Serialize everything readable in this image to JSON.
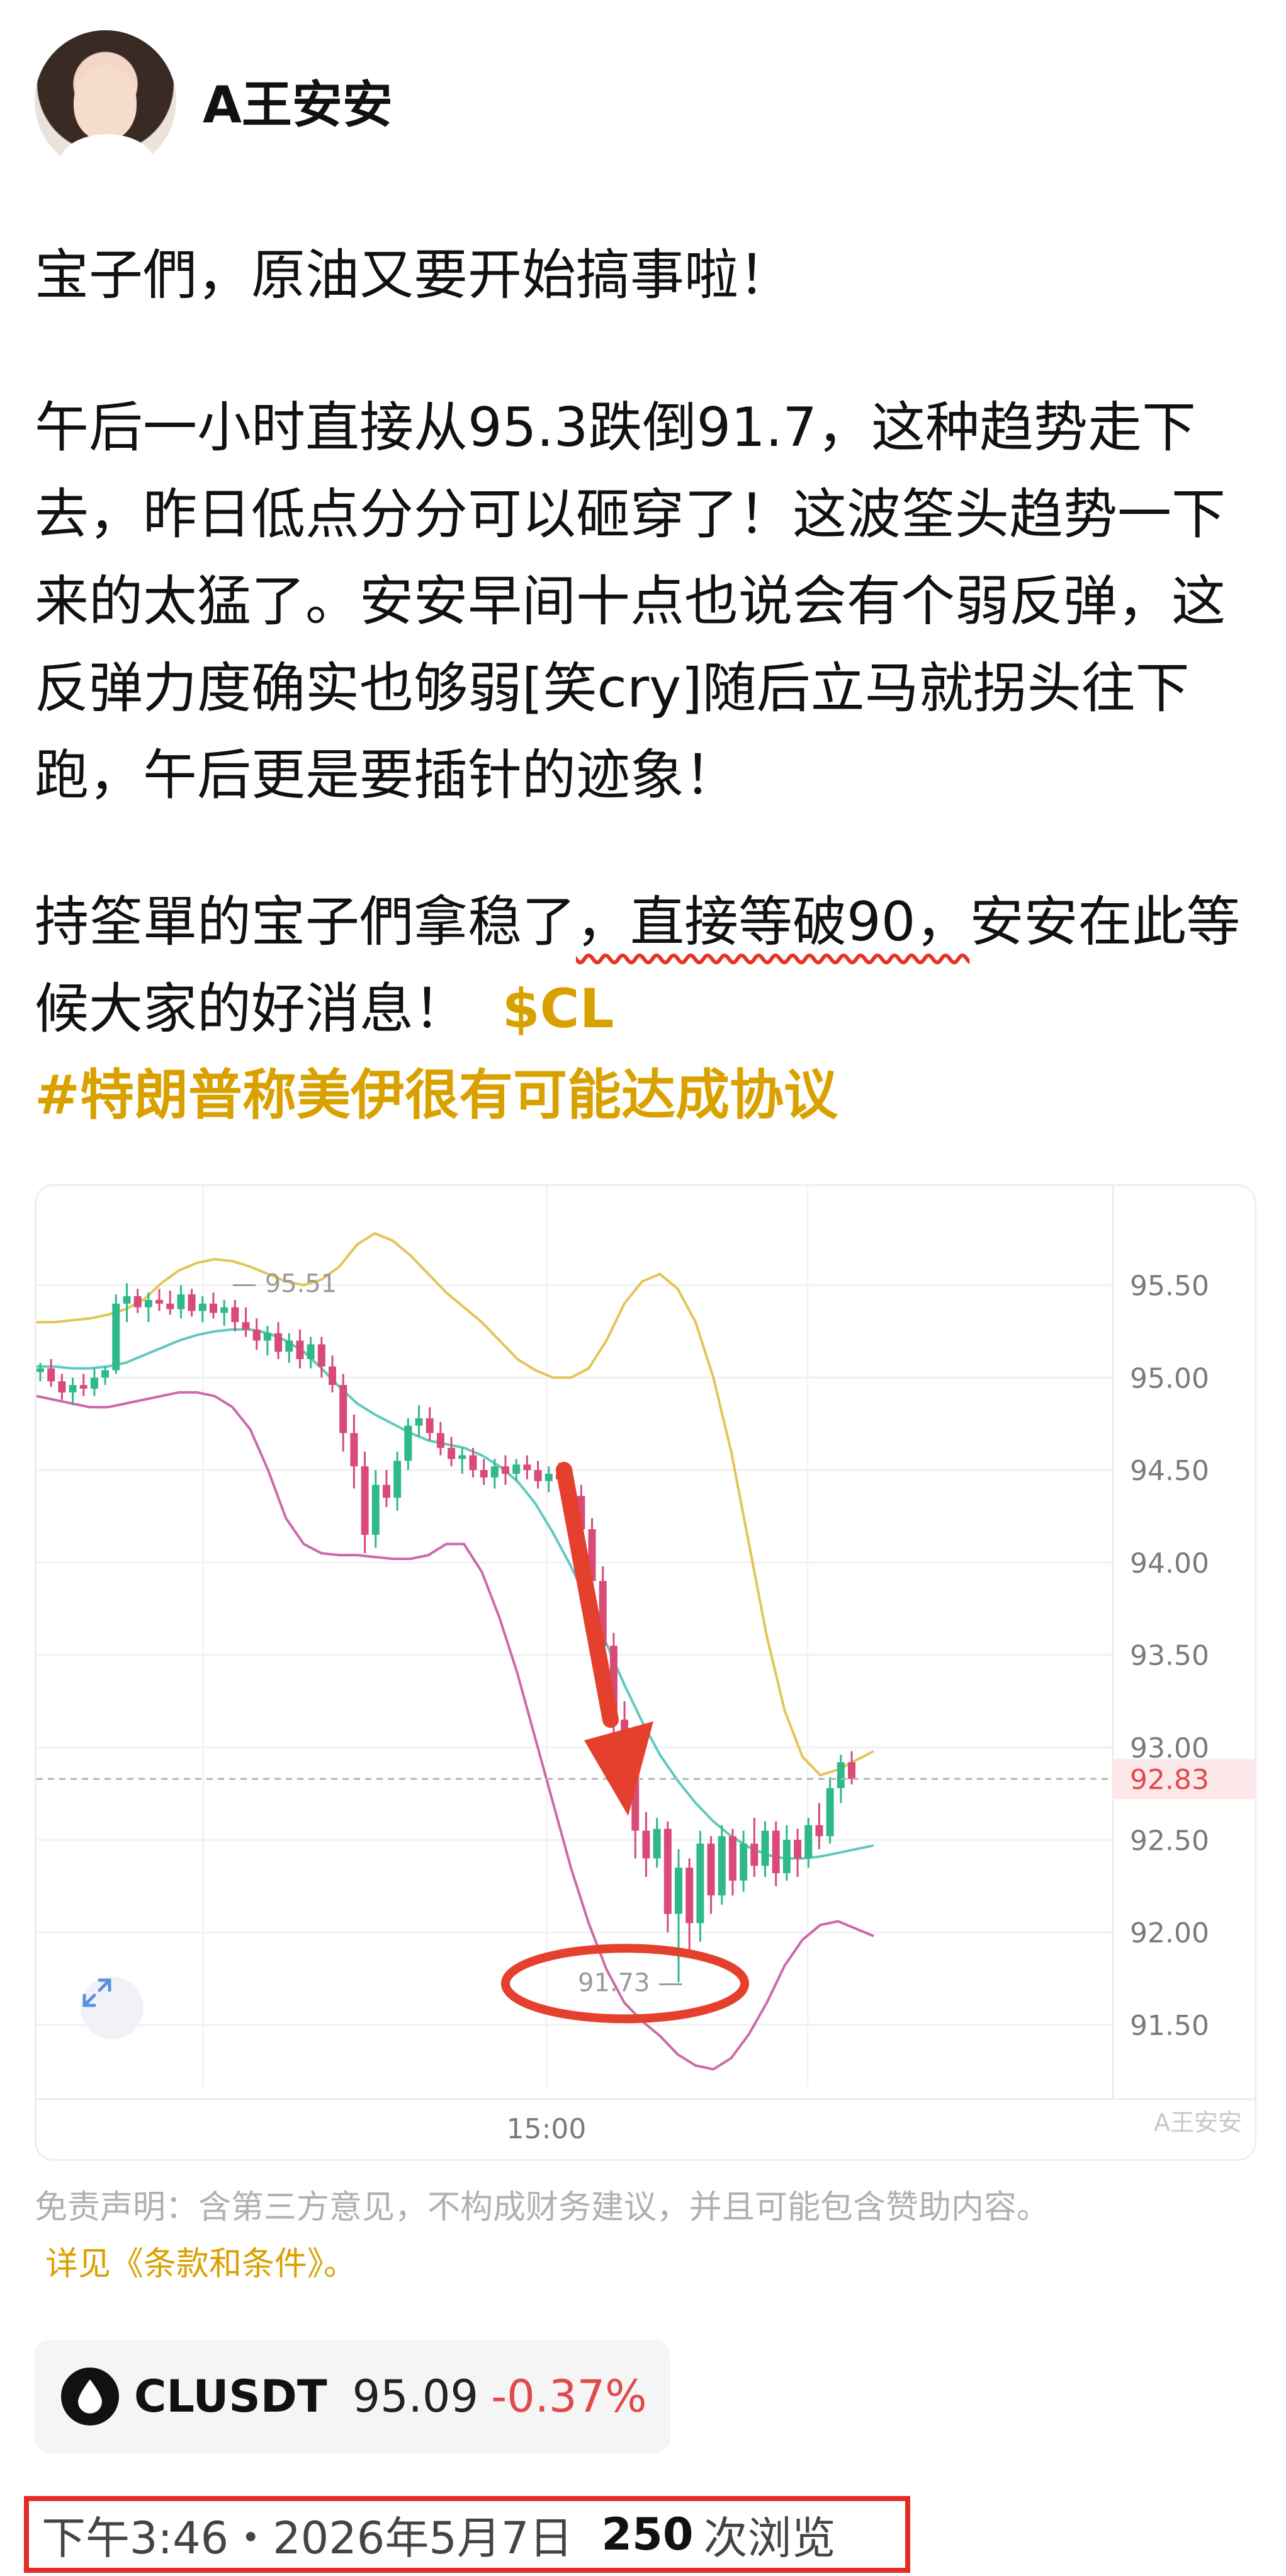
{
  "post": {
    "author": "A王安安",
    "paragraph1": "宝子們，原油又要开始搞事啦！",
    "paragraph2": "午后一小时直接从95.3跌倒91.7，这种趋势走下去，昨日低点分分可以砸穿了！这波筌头趋势一下来的太猛了。安安早间十点也说会有个弱反弹，这反弹力度确实也够弱[笑cry]随后立马就拐头往下跑，午后更是要插针的迹象！",
    "paragraph3_before": "持筌單的宝子們拿稳了",
    "paragraph3_highlight": "，直接等破90，",
    "paragraph3_after": "安安在此等候大家的好消息！",
    "cashtag": "$CL",
    "hashtag": "#特朗普称美伊很有可能达成协议"
  },
  "chart_data": {
    "type": "candlestick",
    "y_ticks": [
      "95.50",
      "95.00",
      "94.50",
      "94.00",
      "93.50",
      "93.00",
      "92.50",
      "92.00",
      "91.50"
    ],
    "ylim": [
      91.2,
      95.9
    ],
    "x_tick": "15:00",
    "current_price": "92.83",
    "high_label": "95.51",
    "low_label": "91.73",
    "watermark": "A王安安",
    "colors": {
      "up": "#2fb98a",
      "down": "#d94a76",
      "upper_band": "#e3c457",
      "mid_band": "#5fc9c0",
      "lower_band": "#cc6aa8",
      "annotation": "#e4402d"
    },
    "candles": [
      [
        95.03,
        95.08,
        94.98,
        95.05
      ],
      [
        95.05,
        95.1,
        94.95,
        94.98
      ],
      [
        94.98,
        95.02,
        94.88,
        94.92
      ],
      [
        94.92,
        95.0,
        94.85,
        94.96
      ],
      [
        94.96,
        95.02,
        94.9,
        94.94
      ],
      [
        94.94,
        95.05,
        94.9,
        95.0
      ],
      [
        95.0,
        95.06,
        94.96,
        95.04
      ],
      [
        95.04,
        95.45,
        95.02,
        95.4
      ],
      [
        95.4,
        95.51,
        95.3,
        95.44
      ],
      [
        95.44,
        95.48,
        95.35,
        95.38
      ],
      [
        95.38,
        95.46,
        95.3,
        95.42
      ],
      [
        95.42,
        95.48,
        95.36,
        95.4
      ],
      [
        95.4,
        95.47,
        95.34,
        95.37
      ],
      [
        95.37,
        95.5,
        95.32,
        95.45
      ],
      [
        95.45,
        95.48,
        95.33,
        95.36
      ],
      [
        95.36,
        95.44,
        95.3,
        95.4
      ],
      [
        95.4,
        95.46,
        95.32,
        95.35
      ],
      [
        95.35,
        95.42,
        95.28,
        95.38
      ],
      [
        95.38,
        95.42,
        95.25,
        95.3
      ],
      [
        95.3,
        95.38,
        95.22,
        95.26
      ],
      [
        95.26,
        95.32,
        95.15,
        95.2
      ],
      [
        95.2,
        95.28,
        95.12,
        95.24
      ],
      [
        95.24,
        95.3,
        95.1,
        95.14
      ],
      [
        95.14,
        95.24,
        95.08,
        95.2
      ],
      [
        95.2,
        95.26,
        95.05,
        95.1
      ],
      [
        95.1,
        95.22,
        95.05,
        95.18
      ],
      [
        95.18,
        95.22,
        95.0,
        95.06
      ],
      [
        95.06,
        95.12,
        94.92,
        94.96
      ],
      [
        94.96,
        95.02,
        94.6,
        94.7
      ],
      [
        94.7,
        94.8,
        94.4,
        94.52
      ],
      [
        94.52,
        94.6,
        94.05,
        94.15
      ],
      [
        94.15,
        94.5,
        94.08,
        94.42
      ],
      [
        94.42,
        94.5,
        94.3,
        94.35
      ],
      [
        94.35,
        94.6,
        94.28,
        94.55
      ],
      [
        94.55,
        94.78,
        94.5,
        94.74
      ],
      [
        94.74,
        94.85,
        94.68,
        94.78
      ],
      [
        94.78,
        94.84,
        94.66,
        94.7
      ],
      [
        94.7,
        94.76,
        94.58,
        94.62
      ],
      [
        94.62,
        94.68,
        94.52,
        94.56
      ],
      [
        94.56,
        94.62,
        94.48,
        94.58
      ],
      [
        94.58,
        94.62,
        94.46,
        94.5
      ],
      [
        94.5,
        94.56,
        94.42,
        94.46
      ],
      [
        94.46,
        94.56,
        94.4,
        94.52
      ],
      [
        94.52,
        94.58,
        94.42,
        94.48
      ],
      [
        94.48,
        94.56,
        94.44,
        94.53
      ],
      [
        94.53,
        94.58,
        94.45,
        94.5
      ],
      [
        94.5,
        94.55,
        94.4,
        94.44
      ],
      [
        94.44,
        94.52,
        94.38,
        94.48
      ],
      [
        94.48,
        94.54,
        94.4,
        94.45
      ],
      [
        94.45,
        94.5,
        94.3,
        94.36
      ],
      [
        94.36,
        94.42,
        94.1,
        94.18
      ],
      [
        94.18,
        94.24,
        93.8,
        93.9
      ],
      [
        93.9,
        93.98,
        93.4,
        93.55
      ],
      [
        93.55,
        93.62,
        93.0,
        93.15
      ],
      [
        93.15,
        93.25,
        92.7,
        92.85
      ],
      [
        92.85,
        92.95,
        92.4,
        92.55
      ],
      [
        92.55,
        92.65,
        92.3,
        92.4
      ],
      [
        92.4,
        92.62,
        92.35,
        92.56
      ],
      [
        92.56,
        92.6,
        92.0,
        92.1
      ],
      [
        92.1,
        92.45,
        91.73,
        92.35
      ],
      [
        92.35,
        92.4,
        91.9,
        92.05
      ],
      [
        92.05,
        92.55,
        91.95,
        92.48
      ],
      [
        92.48,
        92.52,
        92.1,
        92.2
      ],
      [
        92.2,
        92.58,
        92.15,
        92.52
      ],
      [
        92.52,
        92.56,
        92.2,
        92.28
      ],
      [
        92.28,
        92.55,
        92.22,
        92.48
      ],
      [
        92.48,
        92.62,
        92.3,
        92.36
      ],
      [
        92.36,
        92.6,
        92.3,
        92.55
      ],
      [
        92.55,
        92.6,
        92.25,
        92.32
      ],
      [
        92.32,
        92.58,
        92.28,
        92.5
      ],
      [
        92.5,
        92.56,
        92.3,
        92.4
      ],
      [
        92.4,
        92.62,
        92.35,
        92.58
      ],
      [
        92.58,
        92.7,
        92.45,
        92.52
      ],
      [
        92.52,
        92.84,
        92.48,
        92.78
      ],
      [
        92.78,
        92.96,
        92.7,
        92.92
      ],
      [
        92.92,
        92.98,
        92.8,
        92.83
      ]
    ],
    "upper_band": [
      95.3,
      95.3,
      95.31,
      95.32,
      95.34,
      95.37,
      95.42,
      95.51,
      95.58,
      95.62,
      95.64,
      95.63,
      95.6,
      95.56,
      95.52,
      95.5,
      95.53,
      95.6,
      95.72,
      95.78,
      95.74,
      95.66,
      95.56,
      95.46,
      95.38,
      95.3,
      95.2,
      95.1,
      95.04,
      95.0,
      95.0,
      95.05,
      95.2,
      95.4,
      95.52,
      95.56,
      95.48,
      95.3,
      95.0,
      94.6,
      94.1,
      93.6,
      93.2,
      92.95,
      92.85,
      92.88,
      92.93,
      92.98
    ],
    "mid_band": [
      95.06,
      95.06,
      95.05,
      95.05,
      95.06,
      95.08,
      95.12,
      95.16,
      95.2,
      95.23,
      95.25,
      95.26,
      95.26,
      95.24,
      95.2,
      95.14,
      95.05,
      94.95,
      94.86,
      94.8,
      94.75,
      94.7,
      94.66,
      94.64,
      94.62,
      94.58,
      94.52,
      94.44,
      94.32,
      94.16,
      93.98,
      93.78,
      93.56,
      93.34,
      93.14,
      92.96,
      92.82,
      92.7,
      92.6,
      92.52,
      92.46,
      92.42,
      92.4,
      92.4,
      92.41,
      92.43,
      92.45,
      92.47
    ],
    "lower_band": [
      94.9,
      94.88,
      94.86,
      94.84,
      94.84,
      94.86,
      94.88,
      94.9,
      94.92,
      94.92,
      94.9,
      94.84,
      94.72,
      94.5,
      94.24,
      94.1,
      94.05,
      94.04,
      94.04,
      94.03,
      94.02,
      94.02,
      94.04,
      94.1,
      94.1,
      93.95,
      93.7,
      93.4,
      93.05,
      92.7,
      92.35,
      92.05,
      91.8,
      91.62,
      91.52,
      91.44,
      91.34,
      91.28,
      91.26,
      91.32,
      91.45,
      91.62,
      91.82,
      91.96,
      92.04,
      92.06,
      92.02,
      91.98
    ]
  },
  "disclaimer": {
    "text": "免责声明：含第三方意见，不构成财务建议，并且可能包含赞助内容。",
    "link": "详见《条款和条件》。"
  },
  "ticker": {
    "symbol": "CLUSDT",
    "price": "95.09",
    "change": "-0.37%"
  },
  "meta": {
    "time": "下午3:46・2026年5月7日",
    "views": "250",
    "views_label": "次浏览"
  }
}
